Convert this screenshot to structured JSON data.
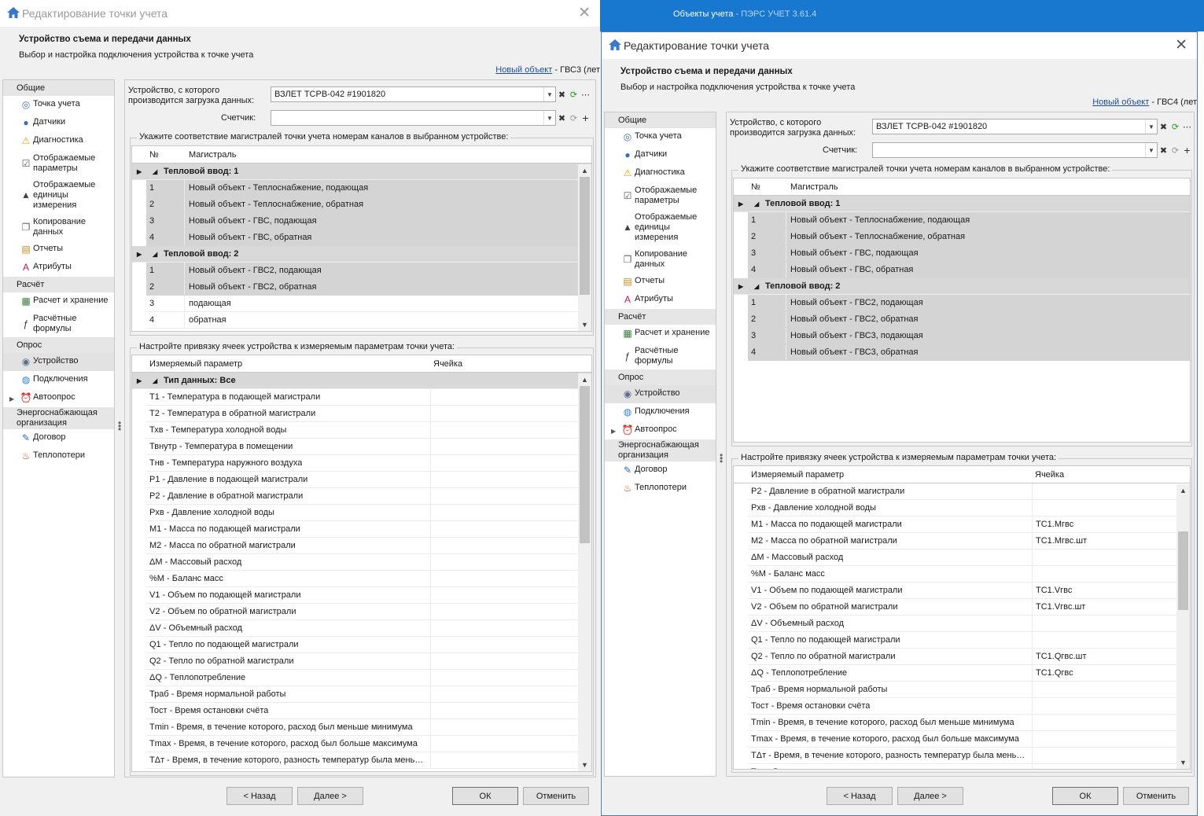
{
  "app": {
    "title": "Объекты учета",
    "version": " - ПЭРС УЧЕТ 3.61.4"
  },
  "colors": {
    "accent": "#1877cf",
    "link": "#1f4fa0",
    "selection": "#d4d4d4"
  },
  "left_dialog": {
    "title": "Редактирование точки учета",
    "header_title": "Устройство съема и передачи данных",
    "header_subtitle": "Выбор и настройка подключения устройства к точке учета",
    "object_link": "Новый объект",
    "object_suffix": " - ГВС3 (лет",
    "device_label": "Устройство, с которого производится загрузка данных:",
    "device_value": "ВЗЛЕТ ТСРВ-042 #1901820",
    "meter_label": "Счетчик:",
    "meter_value": "",
    "channels_legend": "Укажите соответствие магистралей точки учета номерам каналов в выбранном устройстве:",
    "col_no": "№",
    "col_main": "Магистраль",
    "channels": [
      {
        "group": "Тепловой ввод: 1"
      },
      {
        "no": "1",
        "name": "Новый объект - Теплоснабжение, подающая",
        "shaded": true
      },
      {
        "no": "2",
        "name": "Новый объект - Теплоснабжение, обратная",
        "shaded": true
      },
      {
        "no": "3",
        "name": "Новый объект - ГВС, подающая",
        "shaded": true
      },
      {
        "no": "4",
        "name": "Новый объект - ГВС, обратная",
        "shaded": true
      },
      {
        "group": "Тепловой ввод: 2"
      },
      {
        "no": "1",
        "name": "Новый объект - ГВС2, подающая",
        "shaded": true
      },
      {
        "no": "2",
        "name": "Новый объект - ГВС2, обратная",
        "shaded": true
      },
      {
        "no": "3",
        "name": "подающая",
        "shaded": false
      },
      {
        "no": "4",
        "name": "обратная",
        "shaded": false
      }
    ],
    "params_legend": "Настройте привязку ячеек устройства к измеряемым параметрам точки учета:",
    "col_param": "Измеряемый параметр",
    "col_cell": "Ячейка",
    "params_group": "Тип данных: Все",
    "params": [
      {
        "name": "T1 - Температура в подающей магистрали",
        "cell": ""
      },
      {
        "name": "T2 - Температура в обратной магистрали",
        "cell": ""
      },
      {
        "name": "Тхв - Температура холодной воды",
        "cell": ""
      },
      {
        "name": "Твнутр - Температура в помещении",
        "cell": ""
      },
      {
        "name": "Тнв - Температура наружного воздуха",
        "cell": ""
      },
      {
        "name": "P1 - Давление в подающей магистрали",
        "cell": ""
      },
      {
        "name": "P2 - Давление в обратной магистрали",
        "cell": ""
      },
      {
        "name": "Рхв - Давление холодной воды",
        "cell": ""
      },
      {
        "name": "M1 - Масса по подающей магистрали",
        "cell": ""
      },
      {
        "name": "M2 - Масса по обратной магистрали",
        "cell": ""
      },
      {
        "name": "ΔM - Массовый расход",
        "cell": ""
      },
      {
        "name": "%M - Баланс масс",
        "cell": ""
      },
      {
        "name": "V1 - Объем по подающей магистрали",
        "cell": ""
      },
      {
        "name": "V2 - Объем по обратной магистрали",
        "cell": ""
      },
      {
        "name": "ΔV - Объемный расход",
        "cell": ""
      },
      {
        "name": "Q1 - Тепло по подающей магистрали",
        "cell": ""
      },
      {
        "name": "Q2 - Тепло по обратной магистрали",
        "cell": ""
      },
      {
        "name": "ΔQ - Теплопотребление",
        "cell": ""
      },
      {
        "name": "Траб - Время нормальной работы",
        "cell": ""
      },
      {
        "name": "Тост - Время остановки счёта",
        "cell": ""
      },
      {
        "name": "Tmin - Время, в течение которого, расход был меньше минимума",
        "cell": ""
      },
      {
        "name": "Tmax - Время, в течение которого, расход был больше максимума",
        "cell": ""
      },
      {
        "name": "TΔт - Время, в течение которого, разность температур была мень…",
        "cell": ""
      }
    ]
  },
  "right_dialog": {
    "title": "Редактирование точки учета",
    "header_title": "Устройство съема и передачи данных",
    "header_subtitle": "Выбор и настройка подключения устройства к точке учета",
    "object_link": "Новый объект",
    "object_suffix": " - ГВС4 (лет",
    "device_label": "Устройство, с которого производится загрузка данных:",
    "device_value": "ВЗЛЕТ ТСРВ-042 #1901820",
    "meter_label": "Счетчик:",
    "meter_value": "",
    "channels_legend": "Укажите соответствие магистралей точки учета номерам каналов в выбранном устройстве:",
    "col_no": "№",
    "col_main": "Магистраль",
    "channels": [
      {
        "group": "Тепловой ввод: 1"
      },
      {
        "no": "1",
        "name": "Новый объект - Теплоснабжение, подающая",
        "shaded": true
      },
      {
        "no": "2",
        "name": "Новый объект - Теплоснабжение, обратная",
        "shaded": true
      },
      {
        "no": "3",
        "name": "Новый объект - ГВС, подающая",
        "shaded": true
      },
      {
        "no": "4",
        "name": "Новый объект - ГВС, обратная",
        "shaded": true
      },
      {
        "group": "Тепловой ввод: 2"
      },
      {
        "no": "1",
        "name": "Новый объект - ГВС2, подающая",
        "shaded": true
      },
      {
        "no": "2",
        "name": "Новый объект - ГВС2, обратная",
        "shaded": true
      },
      {
        "no": "3",
        "name": "Новый объект - ГВС3, подающая",
        "shaded": true
      },
      {
        "no": "4",
        "name": "Новый объект - ГВС3, обратная",
        "shaded": true
      }
    ],
    "params_legend": "Настройте привязку ячеек устройства к измеряемым параметрам точки учета:",
    "col_param": "Измеряемый параметр",
    "col_cell": "Ячейка",
    "params_group": "",
    "params": [
      {
        "name": "P2 - Давление в обратной магистрали",
        "cell": ""
      },
      {
        "name": "Рхв - Давление холодной воды",
        "cell": ""
      },
      {
        "name": "M1 - Масса по подающей магистрали",
        "cell": "TC1.Мгвс"
      },
      {
        "name": "M2 - Масса по обратной магистрали",
        "cell": "TC1.Мгвс.шт"
      },
      {
        "name": "ΔM - Массовый расход",
        "cell": ""
      },
      {
        "name": "%M - Баланс масс",
        "cell": ""
      },
      {
        "name": "V1 - Объем по подающей магистрали",
        "cell": "TC1.Vгвс"
      },
      {
        "name": "V2 - Объем по обратной магистрали",
        "cell": "TC1.Vгвс.шт"
      },
      {
        "name": "ΔV - Объемный расход",
        "cell": ""
      },
      {
        "name": "Q1 - Тепло по подающей магистрали",
        "cell": ""
      },
      {
        "name": "Q2 - Тепло по обратной магистрали",
        "cell": "TC1.Qгвс.шт"
      },
      {
        "name": "ΔQ - Теплопотребление",
        "cell": "TC1.Qгвс"
      },
      {
        "name": "Траб - Время нормальной работы",
        "cell": ""
      },
      {
        "name": "Тост - Время остановки счёта",
        "cell": ""
      },
      {
        "name": "Tmin - Время, в течение которого, расход был меньше минимума",
        "cell": ""
      },
      {
        "name": "Tmax - Время, в течение которого, расход был больше максимума",
        "cell": ""
      },
      {
        "name": "TΔт - Время, в течение которого, разность температур была мень…",
        "cell": ""
      },
      {
        "name": "Тэп - Время отсутствия электропитания",
        "cell": ""
      }
    ]
  },
  "sidebar": [
    {
      "kind": "group",
      "label": "Общие"
    },
    {
      "kind": "item",
      "label": "Точка учета",
      "icon": "meter-icon"
    },
    {
      "kind": "item",
      "label": "Датчики",
      "icon": "sensor-icon"
    },
    {
      "kind": "item",
      "label": "Диагностика",
      "icon": "warning-icon"
    },
    {
      "kind": "item",
      "label": "Отображаемые параметры",
      "icon": "params-icon"
    },
    {
      "kind": "item",
      "label": "Отображаемые единицы измерения",
      "icon": "weight-icon"
    },
    {
      "kind": "item",
      "label": "Копирование данных",
      "icon": "copy-icon"
    },
    {
      "kind": "item",
      "label": "Отчеты",
      "icon": "report-icon"
    },
    {
      "kind": "item",
      "label": "Атрибуты",
      "icon": "attribute-icon"
    },
    {
      "kind": "group",
      "label": "Расчёт"
    },
    {
      "kind": "item",
      "label": "Расчет и хранение",
      "icon": "calculator-icon"
    },
    {
      "kind": "item",
      "label": "Расчётные формулы",
      "icon": "formula-icon"
    },
    {
      "kind": "group",
      "label": "Опрос"
    },
    {
      "kind": "item",
      "label": "Устройство",
      "icon": "device-icon",
      "selected": true
    },
    {
      "kind": "item",
      "label": "Подключения",
      "icon": "globe-icon"
    },
    {
      "kind": "item",
      "label": "Автоопрос",
      "icon": "alarm-clock-icon",
      "expandable": true
    },
    {
      "kind": "group",
      "label": "Энергоснабжающая организация"
    },
    {
      "kind": "item",
      "label": "Договор",
      "icon": "contract-icon"
    },
    {
      "kind": "item",
      "label": "Теплопотери",
      "icon": "fire-icon"
    }
  ],
  "buttons": {
    "back": "< Назад",
    "next": "Далее >",
    "ok": "ОК",
    "cancel": "Отменить"
  }
}
